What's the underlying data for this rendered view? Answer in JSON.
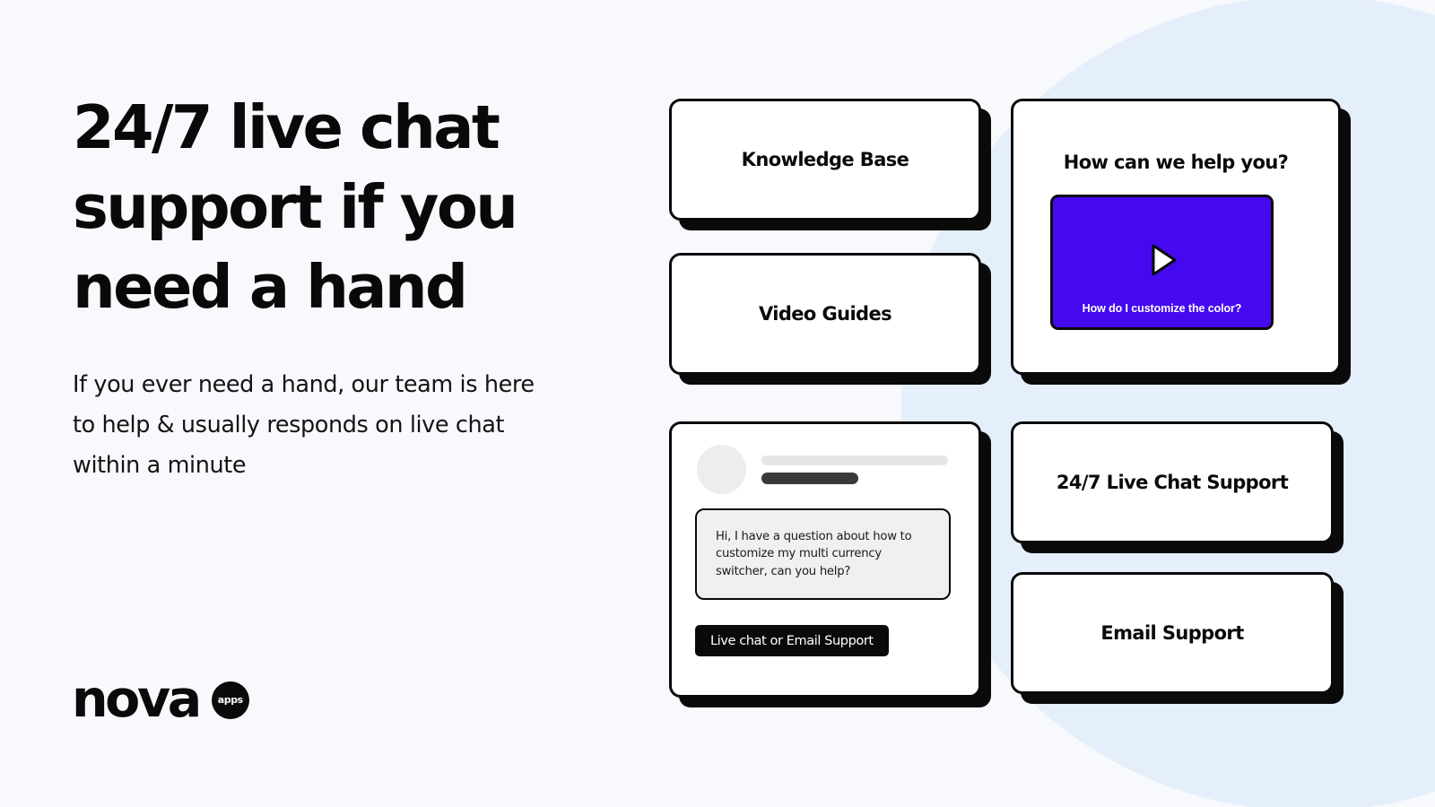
{
  "theme": {
    "page_background": "#f7f9fd",
    "circle_background": "#e4effb",
    "ink": "#0a0a0a",
    "accent_purple": "#4409ee",
    "bubble_background": "#f0f0f0",
    "avatar_gray": "#ededed",
    "skeleton_light": "#e6e6e6",
    "skeleton_dark": "#3a3a3a"
  },
  "hero": {
    "title": "24/7 live chat support if you need a hand",
    "subtitle": "If you ever need a hand, our team is here to help & usually responds on live chat within a minute"
  },
  "logo": {
    "wordmark": "nova",
    "badge_text": "apps"
  },
  "cards": {
    "knowledge_base": {
      "label": "Knowledge Base"
    },
    "video_guides": {
      "label": "Video Guides"
    },
    "live_chat_support": {
      "label": "24/7 Live Chat Support"
    },
    "email_support": {
      "label": "Email Support"
    },
    "help": {
      "title": "How can we help you?",
      "video_caption": "How do I customize the color?",
      "play_icon": "play-icon"
    },
    "chat": {
      "message": "Hi, I have a question about how to customize my multi currency switcher, can you help?",
      "cta_label": "Live chat or Email Support"
    }
  }
}
